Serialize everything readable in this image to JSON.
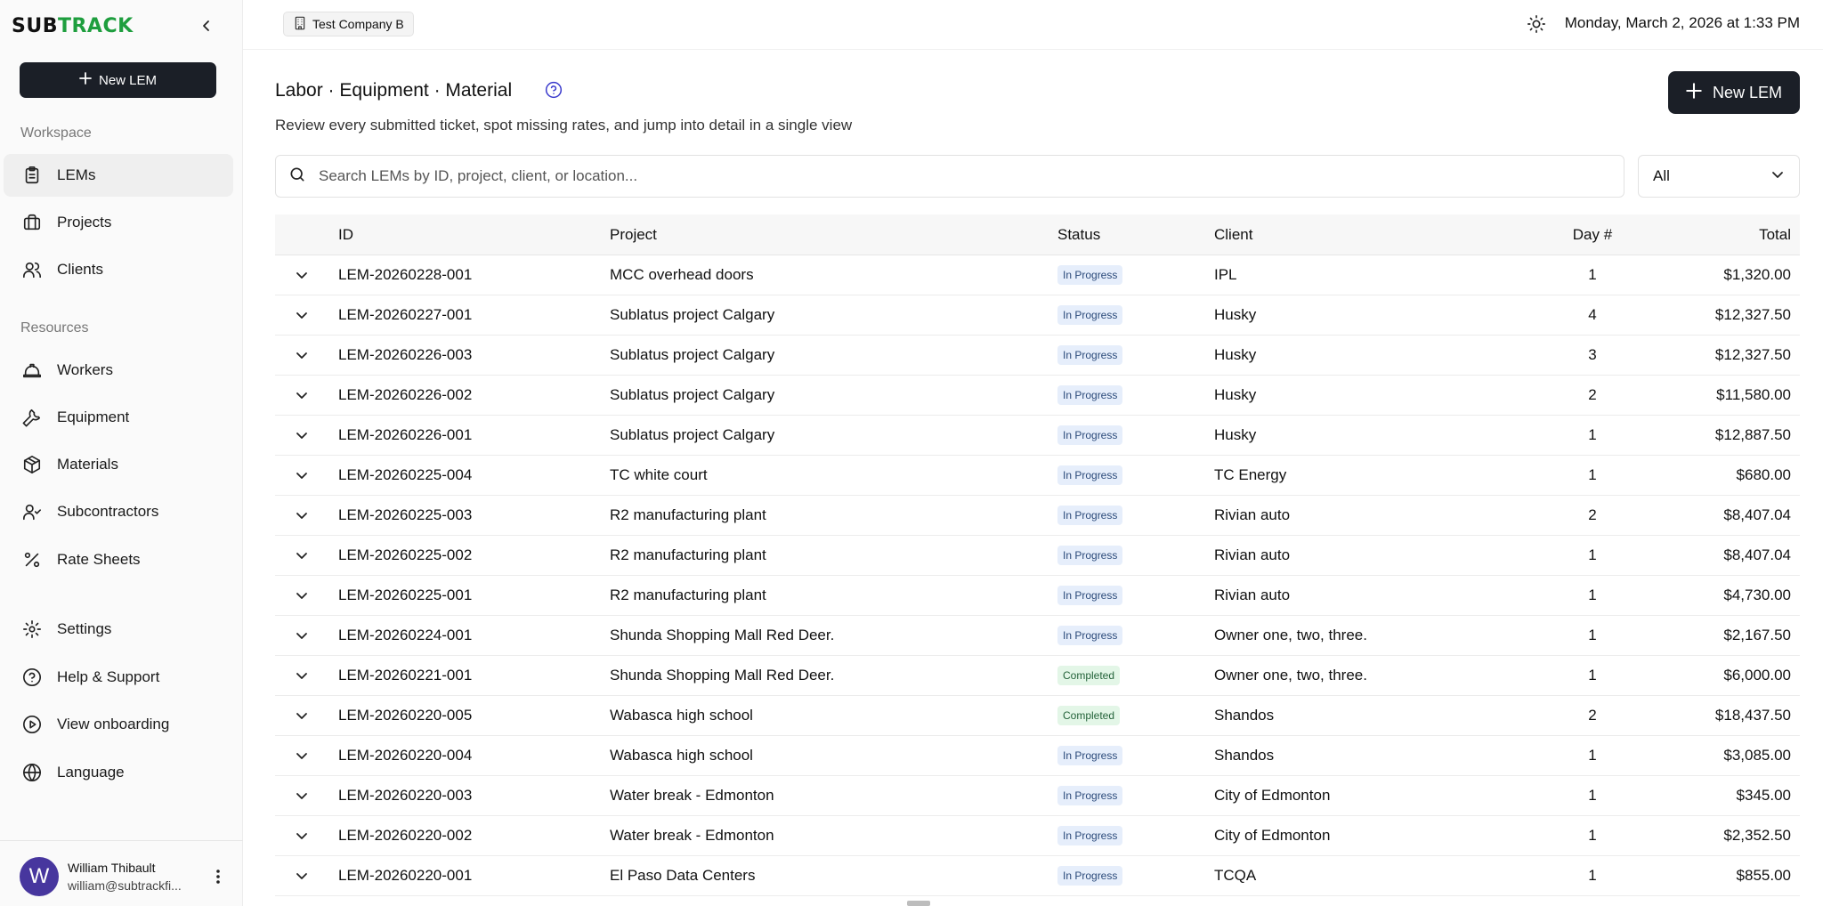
{
  "app": {
    "logo_sub": "SUB",
    "logo_track": "TRACK",
    "brand_color": "#1e9e3e"
  },
  "sidebar": {
    "new_lem_label": "New LEM",
    "workspace_label": "Workspace",
    "resources_label": "Resources",
    "workspace_items": [
      {
        "label": "LEMs",
        "icon": "clipboard-icon",
        "active": true
      },
      {
        "label": "Projects",
        "icon": "briefcase-icon"
      },
      {
        "label": "Clients",
        "icon": "users-icon"
      }
    ],
    "resource_items": [
      {
        "label": "Workers",
        "icon": "hard-hat-icon"
      },
      {
        "label": "Equipment",
        "icon": "wrench-icon"
      },
      {
        "label": "Materials",
        "icon": "package-icon"
      },
      {
        "label": "Subcontractors",
        "icon": "user-check-icon"
      },
      {
        "label": "Rate Sheets",
        "icon": "percent-icon"
      }
    ],
    "bottom_items": [
      {
        "label": "Settings",
        "icon": "gear-icon"
      },
      {
        "label": "Help & Support",
        "icon": "help-circle-icon"
      },
      {
        "label": "View onboarding",
        "icon": "play-circle-icon"
      },
      {
        "label": "Language",
        "icon": "globe-icon"
      }
    ],
    "user": {
      "initial": "W",
      "name": "William Thibault",
      "email": "william@subtrackfi..."
    }
  },
  "topbar": {
    "company": "Test Company B",
    "datetime": "Monday, March 2, 2026 at 1:33 PM"
  },
  "main": {
    "title": "Labor · Equipment · Material",
    "subtitle": "Review every submitted ticket, spot missing rates, and jump into detail in a single view",
    "new_lem_label": "New LEM",
    "search_placeholder": "Search LEMs by ID, project, client, or location...",
    "filter_value": "All"
  },
  "table": {
    "columns": {
      "id": "ID",
      "project": "Project",
      "status": "Status",
      "client": "Client",
      "day": "Day #",
      "total": "Total"
    },
    "rows": [
      {
        "id": "LEM-20260228-001",
        "project": "MCC overhead doors",
        "status": "In Progress",
        "client": "IPL",
        "day": "1",
        "total": "$1,320.00"
      },
      {
        "id": "LEM-20260227-001",
        "project": "Sublatus project Calgary",
        "status": "In Progress",
        "client": "Husky",
        "day": "4",
        "total": "$12,327.50"
      },
      {
        "id": "LEM-20260226-003",
        "project": "Sublatus project Calgary",
        "status": "In Progress",
        "client": "Husky",
        "day": "3",
        "total": "$12,327.50"
      },
      {
        "id": "LEM-20260226-002",
        "project": "Sublatus project Calgary",
        "status": "In Progress",
        "client": "Husky",
        "day": "2",
        "total": "$11,580.00"
      },
      {
        "id": "LEM-20260226-001",
        "project": "Sublatus project Calgary",
        "status": "In Progress",
        "client": "Husky",
        "day": "1",
        "total": "$12,887.50"
      },
      {
        "id": "LEM-20260225-004",
        "project": "TC white court",
        "status": "In Progress",
        "client": "TC Energy",
        "day": "1",
        "total": "$680.00"
      },
      {
        "id": "LEM-20260225-003",
        "project": "R2 manufacturing plant",
        "status": "In Progress",
        "client": "Rivian auto",
        "day": "2",
        "total": "$8,407.04"
      },
      {
        "id": "LEM-20260225-002",
        "project": "R2 manufacturing plant",
        "status": "In Progress",
        "client": "Rivian auto",
        "day": "1",
        "total": "$8,407.04"
      },
      {
        "id": "LEM-20260225-001",
        "project": "R2 manufacturing plant",
        "status": "In Progress",
        "client": "Rivian auto",
        "day": "1",
        "total": "$4,730.00"
      },
      {
        "id": "LEM-20260224-001",
        "project": "Shunda Shopping Mall Red Deer.",
        "status": "In Progress",
        "client": "Owner one, two, three.",
        "day": "1",
        "total": "$2,167.50"
      },
      {
        "id": "LEM-20260221-001",
        "project": "Shunda Shopping Mall Red Deer.",
        "status": "Completed",
        "client": "Owner one, two, three.",
        "day": "1",
        "total": "$6,000.00"
      },
      {
        "id": "LEM-20260220-005",
        "project": "Wabasca high school",
        "status": "Completed",
        "client": "Shandos",
        "day": "2",
        "total": "$18,437.50"
      },
      {
        "id": "LEM-20260220-004",
        "project": "Wabasca high school",
        "status": "In Progress",
        "client": "Shandos",
        "day": "1",
        "total": "$3,085.00"
      },
      {
        "id": "LEM-20260220-003",
        "project": "Water break - Edmonton",
        "status": "In Progress",
        "client": "City of Edmonton",
        "day": "1",
        "total": "$345.00"
      },
      {
        "id": "LEM-20260220-002",
        "project": "Water break - Edmonton",
        "status": "In Progress",
        "client": "City of Edmonton",
        "day": "1",
        "total": "$2,352.50"
      },
      {
        "id": "LEM-20260220-001",
        "project": "El Paso Data Centers",
        "status": "In Progress",
        "client": "TCQA",
        "day": "1",
        "total": "$855.00"
      }
    ]
  }
}
